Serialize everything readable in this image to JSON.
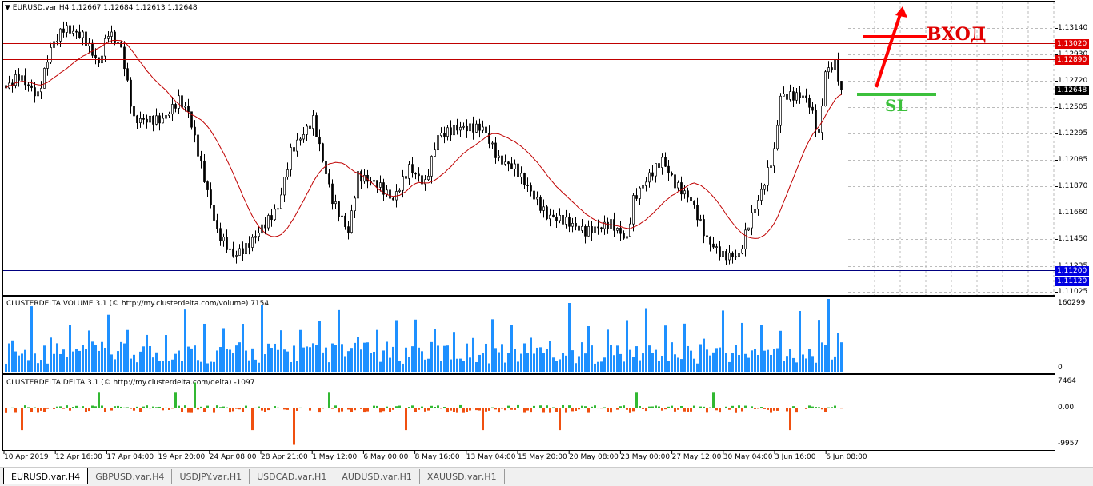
{
  "header": {
    "symbol_info": "EURUSD.var,H4  1.12667 1.12684 1.12613 1.12648"
  },
  "indicators": {
    "volume_label": "CLUSTERDELTA VOLUME 3.1 (© http://my.clusterdelta.com/volume) 7154",
    "volume_max": "160299",
    "volume_zero": "0",
    "delta_label": "CLUSTERDELTA DELTA 3.1 (© http://my.clusterdelta.com/delta) -1097",
    "delta_max": "7464",
    "delta_zero": "0.00",
    "delta_min": "-9957"
  },
  "price_axis": {
    "ticks": [
      "1.13140",
      "1.12930",
      "1.12720",
      "1.12505",
      "1.12295",
      "1.12085",
      "1.11870",
      "1.11660",
      "1.11450",
      "1.11235",
      "1.11025"
    ],
    "tick_values": [
      1.1314,
      1.1293,
      1.1272,
      1.12505,
      1.12295,
      1.12085,
      1.1187,
      1.1166,
      1.1145,
      1.11235,
      1.11025
    ],
    "levels": [
      {
        "label": "1.13020",
        "value": 1.1302,
        "color": "#e00000"
      },
      {
        "label": "1.12890",
        "value": 1.1289,
        "color": "#e00000"
      },
      {
        "label": "1.12648",
        "value": 1.12648,
        "color": "#000000"
      },
      {
        "label": "1.11200",
        "value": 1.112,
        "color": "#0000e0"
      },
      {
        "label": "1.11120",
        "value": 1.1112,
        "color": "#0000e0"
      }
    ]
  },
  "annotations": {
    "entry": "ВХОД",
    "stop": "SL",
    "entry_color": "#ff0000",
    "stop_color": "#3cc03c"
  },
  "time_axis": [
    "10 Apr 2019",
    "12 Apr 16:00",
    "17 Apr 04:00",
    "19 Apr 20:00",
    "24 Apr 08:00",
    "28 Apr 21:00",
    "1 May 12:00",
    "6 May 00:00",
    "8 May 16:00",
    "13 May 04:00",
    "15 May 20:00",
    "20 May 08:00",
    "23 May 00:00",
    "27 May 12:00",
    "30 May 04:00",
    "3 Jun 16:00",
    "6 Jun 08:00"
  ],
  "price_path": [
    [
      0,
      1.1266
    ],
    [
      4,
      1.12756
    ],
    [
      10,
      1.12596
    ],
    [
      14,
      1.1298
    ],
    [
      18,
      1.1314
    ],
    [
      24,
      1.13076
    ],
    [
      29,
      1.12852
    ],
    [
      32,
      1.13108
    ],
    [
      36,
      1.1298
    ],
    [
      40,
      1.12404
    ],
    [
      44,
      1.12404
    ],
    [
      49,
      1.12404
    ],
    [
      54,
      1.12564
    ],
    [
      57,
      1.12468
    ],
    [
      60,
      1.12148
    ],
    [
      66,
      1.11508
    ],
    [
      71,
      1.11316
    ],
    [
      75,
      1.1138
    ],
    [
      79,
      1.11508
    ],
    [
      85,
      1.117
    ],
    [
      89,
      1.12148
    ],
    [
      96,
      1.12404
    ],
    [
      99,
      1.12084
    ],
    [
      102,
      1.11764
    ],
    [
      107,
      1.11508
    ],
    [
      110,
      1.11956
    ],
    [
      116,
      1.11892
    ],
    [
      121,
      1.11764
    ],
    [
      126,
      1.1202
    ],
    [
      131,
      1.11892
    ],
    [
      135,
      1.12276
    ],
    [
      141,
      1.1234
    ],
    [
      149,
      1.1234
    ],
    [
      154,
      1.12084
    ],
    [
      159,
      1.1202
    ],
    [
      164,
      1.11828
    ],
    [
      169,
      1.11636
    ],
    [
      174,
      1.11604
    ],
    [
      181,
      1.11508
    ],
    [
      189,
      1.11572
    ],
    [
      194,
      1.11444
    ],
    [
      196,
      1.11764
    ],
    [
      201,
      1.11956
    ],
    [
      205,
      1.12084
    ],
    [
      209,
      1.11892
    ],
    [
      214,
      1.11764
    ],
    [
      219,
      1.11444
    ],
    [
      224,
      1.11316
    ],
    [
      229,
      1.11316
    ],
    [
      232,
      1.11572
    ],
    [
      236,
      1.11828
    ],
    [
      240,
      1.12148
    ],
    [
      242,
      1.12596
    ],
    [
      249,
      1.12596
    ],
    [
      251,
      1.12532
    ],
    [
      254,
      1.12276
    ],
    [
      256,
      1.12788
    ],
    [
      259,
      1.12852
    ],
    [
      261,
      1.12647
    ]
  ],
  "tabs": [
    "EURUSD.var,H4",
    "GBPUSD.var,H4",
    "USDJPY.var,H1",
    "USDCAD.var,H1",
    "AUDUSD.var,H1",
    "XAUUSD.var,H1"
  ]
}
